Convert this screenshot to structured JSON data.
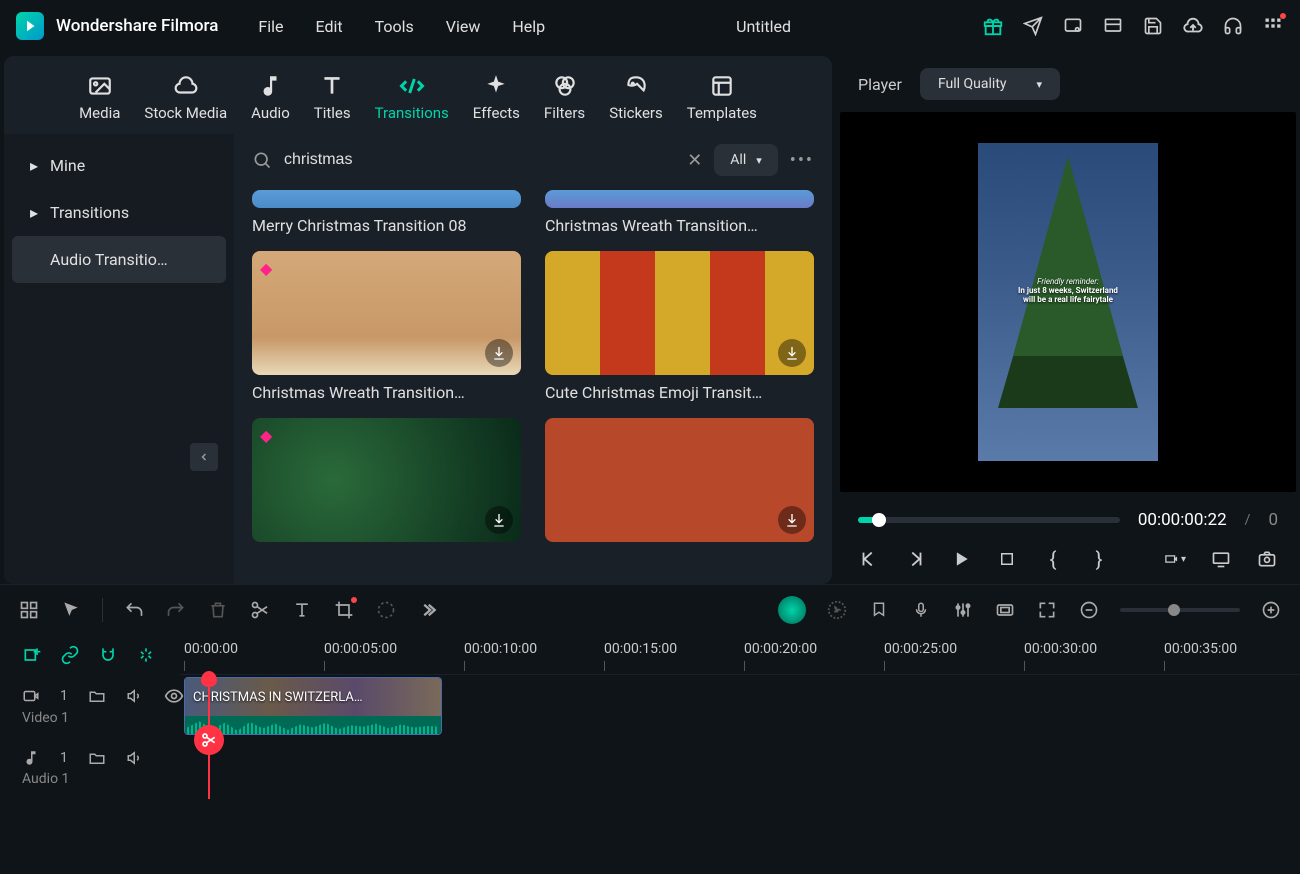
{
  "app_name": "Wondershare Filmora",
  "menu": {
    "file": "File",
    "edit": "Edit",
    "tools": "Tools",
    "view": "View",
    "help": "Help"
  },
  "document_title": "Untitled",
  "tabs": {
    "media": "Media",
    "stock_media": "Stock Media",
    "audio": "Audio",
    "titles": "Titles",
    "transitions": "Transitions",
    "effects": "Effects",
    "filters": "Filters",
    "stickers": "Stickers",
    "templates": "Templates"
  },
  "sidebar": {
    "mine": "Mine",
    "transitions": "Transitions",
    "audio_transitions": "Audio Transitio…"
  },
  "search": {
    "value": "christmas",
    "filter_label": "All"
  },
  "cards": {
    "c1": "Merry Christmas Transition 08",
    "c2": "Christmas Wreath Transition…",
    "c3": "Christmas Wreath Transition…",
    "c4": "Cute Christmas Emoji Transit…"
  },
  "player": {
    "label": "Player",
    "quality": "Full Quality",
    "current_time": "00:00:00:22",
    "caption_line1": "Friendly reminder:",
    "caption_line2": "In just 8 weeks, Switzerland",
    "caption_line3": "will be a real life fairytale"
  },
  "timeline": {
    "ruler": [
      "00:00:00",
      "00:00:05:00",
      "00:00:10:00",
      "00:00:15:00",
      "00:00:20:00",
      "00:00:25:00",
      "00:00:30:00",
      "00:00:35:00"
    ],
    "video_track_label": "Video 1",
    "audio_track_label": "Audio 1",
    "video_track_num": "1",
    "audio_track_num": "1",
    "clip_title": "CHRISTMAS IN SWITZERLA…"
  }
}
